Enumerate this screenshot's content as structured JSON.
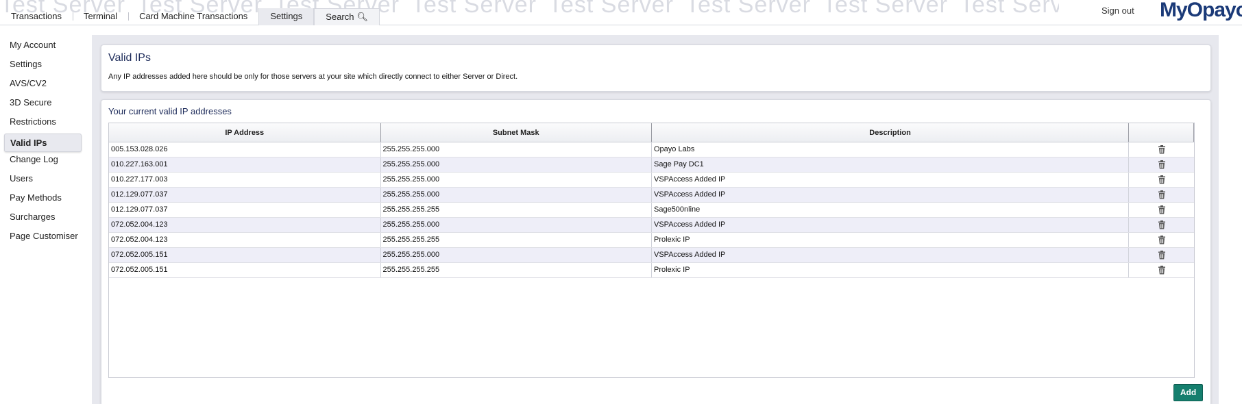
{
  "header": {
    "watermark_text": "Test Server",
    "tabs": [
      {
        "label": "Transactions"
      },
      {
        "label": "Terminal"
      },
      {
        "label": "Card Machine Transactions"
      },
      {
        "label": "Settings"
      },
      {
        "label": "Search"
      }
    ],
    "active_tab": "Settings",
    "sign_out": "Sign out",
    "logo": "MyOpayo"
  },
  "sidebar": {
    "items": [
      {
        "label": "My Account"
      },
      {
        "label": "Settings"
      },
      {
        "label": "AVS/CV2"
      },
      {
        "label": "3D Secure"
      },
      {
        "label": "Restrictions"
      },
      {
        "label": "Valid IPs"
      },
      {
        "label": "Change Log"
      },
      {
        "label": "Users"
      },
      {
        "label": "Pay Methods"
      },
      {
        "label": "Surcharges"
      },
      {
        "label": "Page Customiser"
      }
    ],
    "active_item": "Valid IPs"
  },
  "intro": {
    "title": "Valid IPs",
    "description": "Any IP addresses added here should be only for those servers at your site which directly connect to either Server or Direct."
  },
  "ip_list": {
    "title": "Your current valid IP addresses",
    "columns": [
      "IP Address",
      "Subnet Mask",
      "Description",
      ""
    ],
    "rows": [
      {
        "ip": "005.153.028.026",
        "mask": "255.255.255.000",
        "description": "Opayo Labs"
      },
      {
        "ip": "010.227.163.001",
        "mask": "255.255.255.000",
        "description": "Sage Pay DC1"
      },
      {
        "ip": "010.227.177.003",
        "mask": "255.255.255.000",
        "description": "VSPAccess Added IP"
      },
      {
        "ip": "012.129.077.037",
        "mask": "255.255.255.000",
        "description": "VSPAccess Added IP"
      },
      {
        "ip": "012.129.077.037",
        "mask": "255.255.255.255",
        "description": "Sage500nline"
      },
      {
        "ip": "072.052.004.123",
        "mask": "255.255.255.000",
        "description": "VSPAccess Added IP"
      },
      {
        "ip": "072.052.004.123",
        "mask": "255.255.255.255",
        "description": "Prolexic IP"
      },
      {
        "ip": "072.052.005.151",
        "mask": "255.255.255.000",
        "description": "VSPAccess Added IP"
      },
      {
        "ip": "072.052.005.151",
        "mask": "255.255.255.255",
        "description": "Prolexic IP"
      }
    ],
    "add_label": "Add",
    "colors": {
      "add_button": "#157f6e",
      "row_alt": "#eeeef8",
      "title": "#1d2b5a"
    }
  }
}
